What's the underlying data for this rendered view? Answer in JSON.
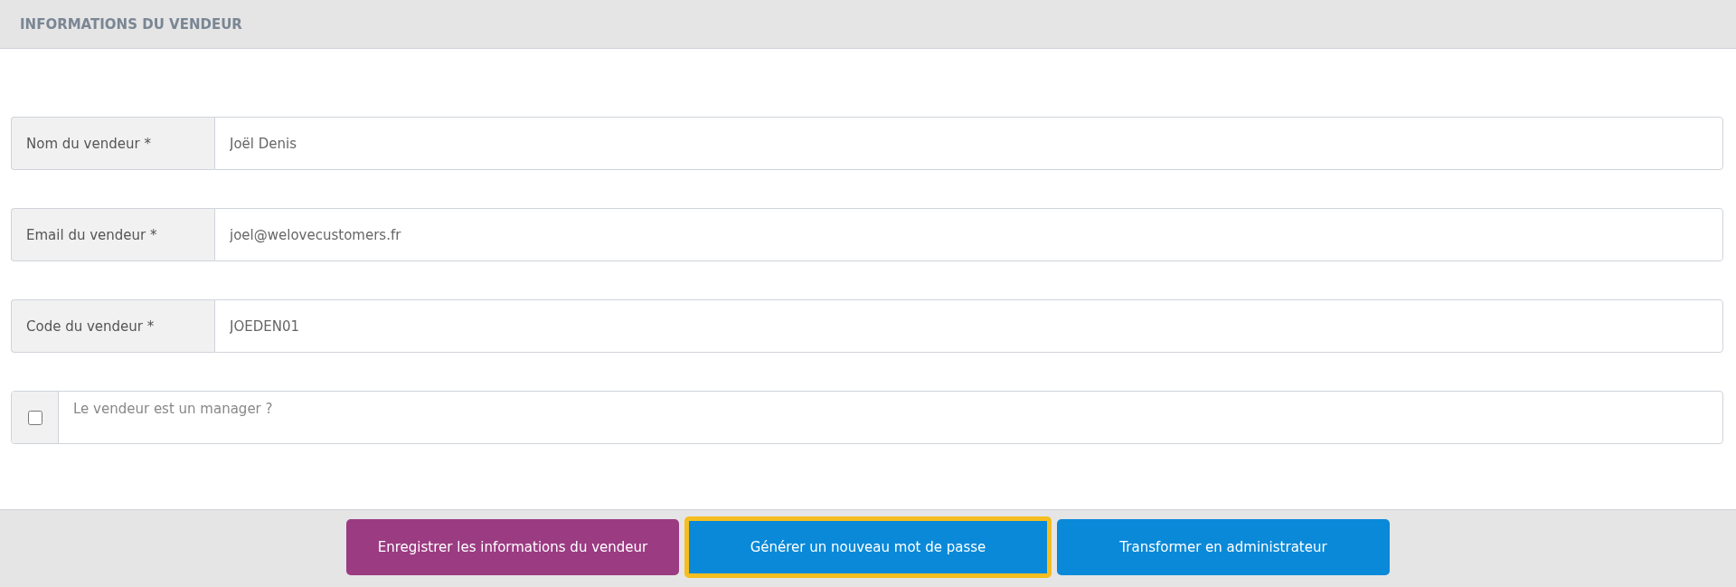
{
  "panel": {
    "title": "INFORMATIONS DU VENDEUR"
  },
  "fields": [
    {
      "kind": "text",
      "label": "Nom du vendeur *",
      "value": "Joël Denis"
    },
    {
      "kind": "text",
      "label": "Email du vendeur *",
      "value": "joel@welovecustomers.fr"
    },
    {
      "kind": "text",
      "label": "Code du vendeur *",
      "value": "JOEDEN01"
    },
    {
      "kind": "checkbox",
      "label": "Le vendeur est un manager ?",
      "checked": false
    }
  ],
  "buttons": [
    {
      "label": "Enregistrer les informations du vendeur",
      "color": "#9b3b82",
      "highlighted": false
    },
    {
      "label": "Générer un nouveau mot de passe",
      "color": "#0a89d8",
      "highlighted": true
    },
    {
      "label": "Transformer en administrateur",
      "color": "#0a89d8",
      "highlighted": false
    }
  ]
}
